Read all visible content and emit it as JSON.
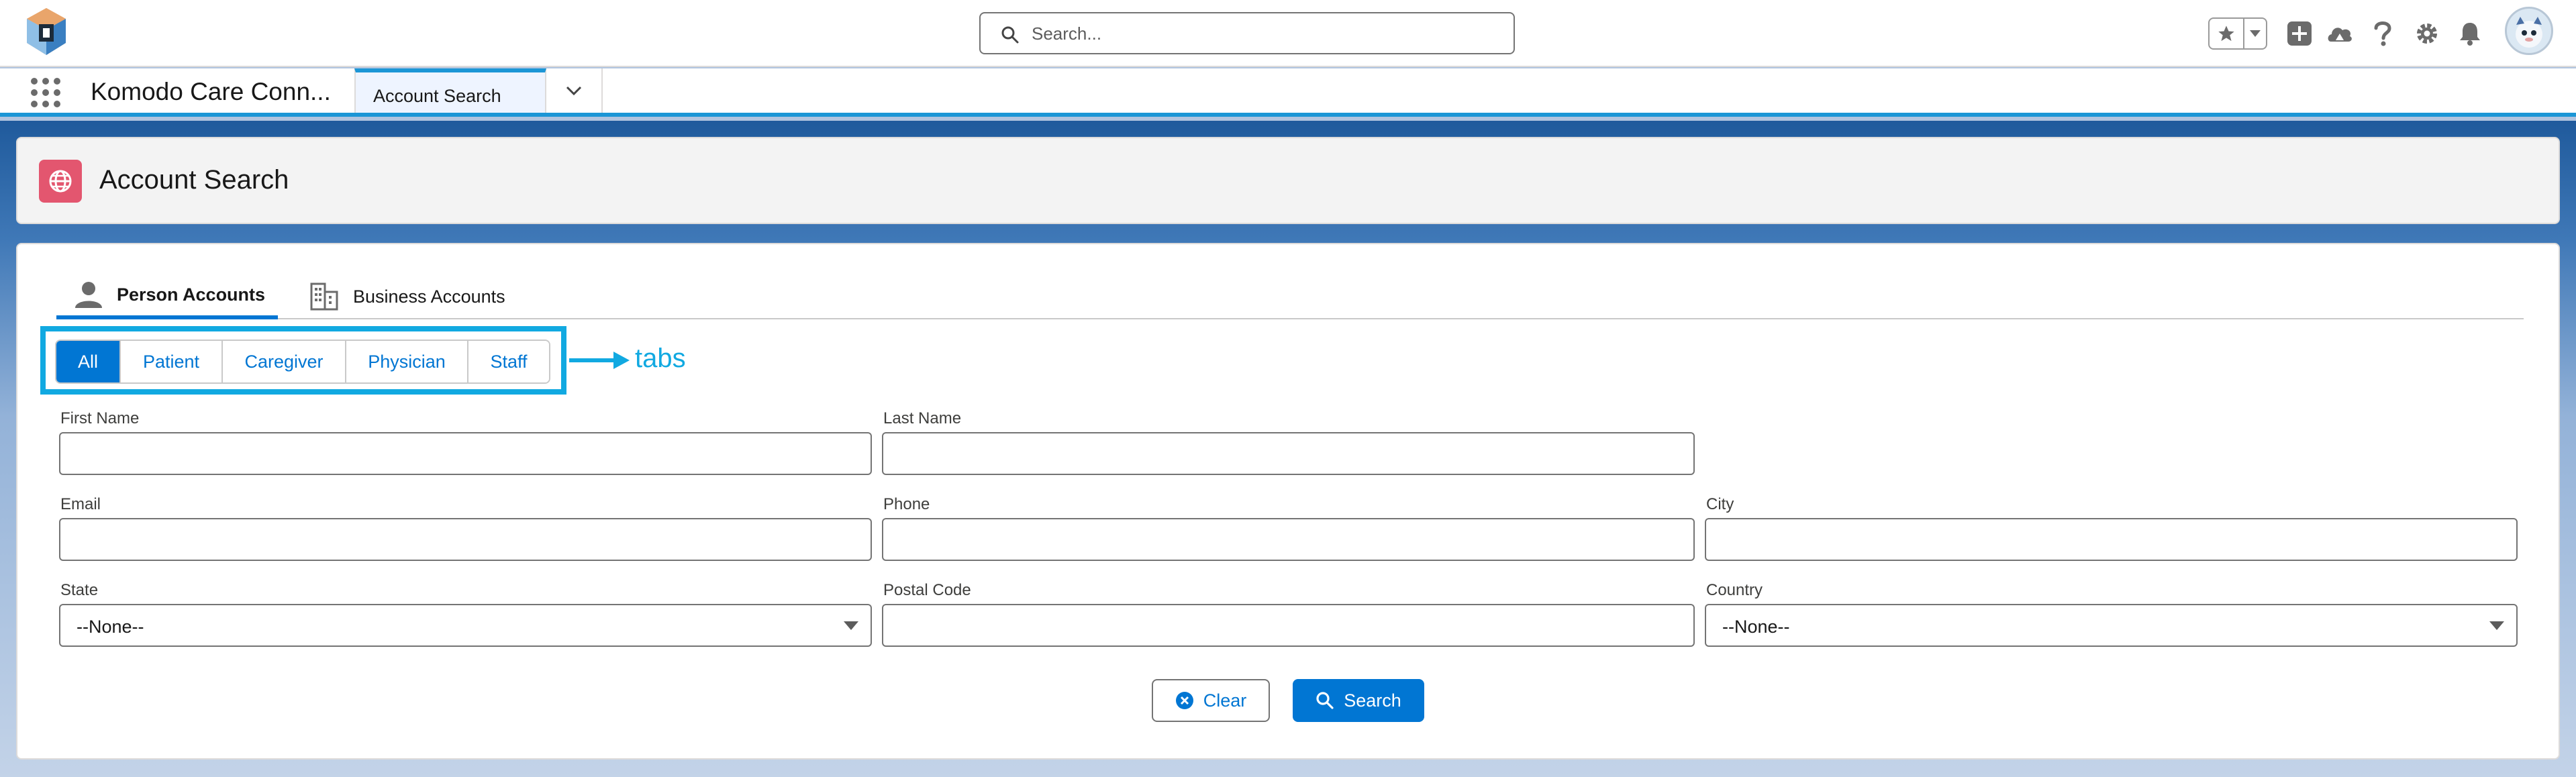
{
  "global_header": {
    "search_placeholder": "Search...",
    "icons": [
      "favorites-star-icon",
      "favorites-dropdown-icon",
      "global-actions-plus-icon",
      "trailhead-icon",
      "help-icon",
      "setup-gear-icon",
      "notifications-bell-icon",
      "user-avatar"
    ]
  },
  "nav": {
    "app_name": "Komodo Care Conn...",
    "active_tab": "Account Search"
  },
  "page_header": {
    "title": "Account Search",
    "icon": "globe-icon",
    "icon_color": "#e3566f"
  },
  "tabs": [
    {
      "label": "Person Accounts",
      "icon": "person-icon",
      "active": true
    },
    {
      "label": "Business Accounts",
      "icon": "building-icon",
      "active": false
    }
  ],
  "filter_buttons": [
    {
      "label": "All",
      "selected": true
    },
    {
      "label": "Patient",
      "selected": false
    },
    {
      "label": "Caregiver",
      "selected": false
    },
    {
      "label": "Physician",
      "selected": false
    },
    {
      "label": "Staff",
      "selected": false
    }
  ],
  "annotation": {
    "label": "tabs",
    "color": "#11a9e1"
  },
  "form": {
    "first_name": {
      "label": "First Name",
      "value": ""
    },
    "last_name": {
      "label": "Last Name",
      "value": ""
    },
    "email": {
      "label": "Email",
      "value": ""
    },
    "phone": {
      "label": "Phone",
      "value": ""
    },
    "city": {
      "label": "City",
      "value": ""
    },
    "state": {
      "label": "State",
      "value": "--None--"
    },
    "postal_code": {
      "label": "Postal Code",
      "value": ""
    },
    "country": {
      "label": "Country",
      "value": "--None--"
    }
  },
  "actions": {
    "clear_label": "Clear",
    "search_label": "Search"
  },
  "colors": {
    "brand": "#0176d3",
    "nav_accent": "#1b96d6",
    "annotation": "#11a9e1"
  }
}
